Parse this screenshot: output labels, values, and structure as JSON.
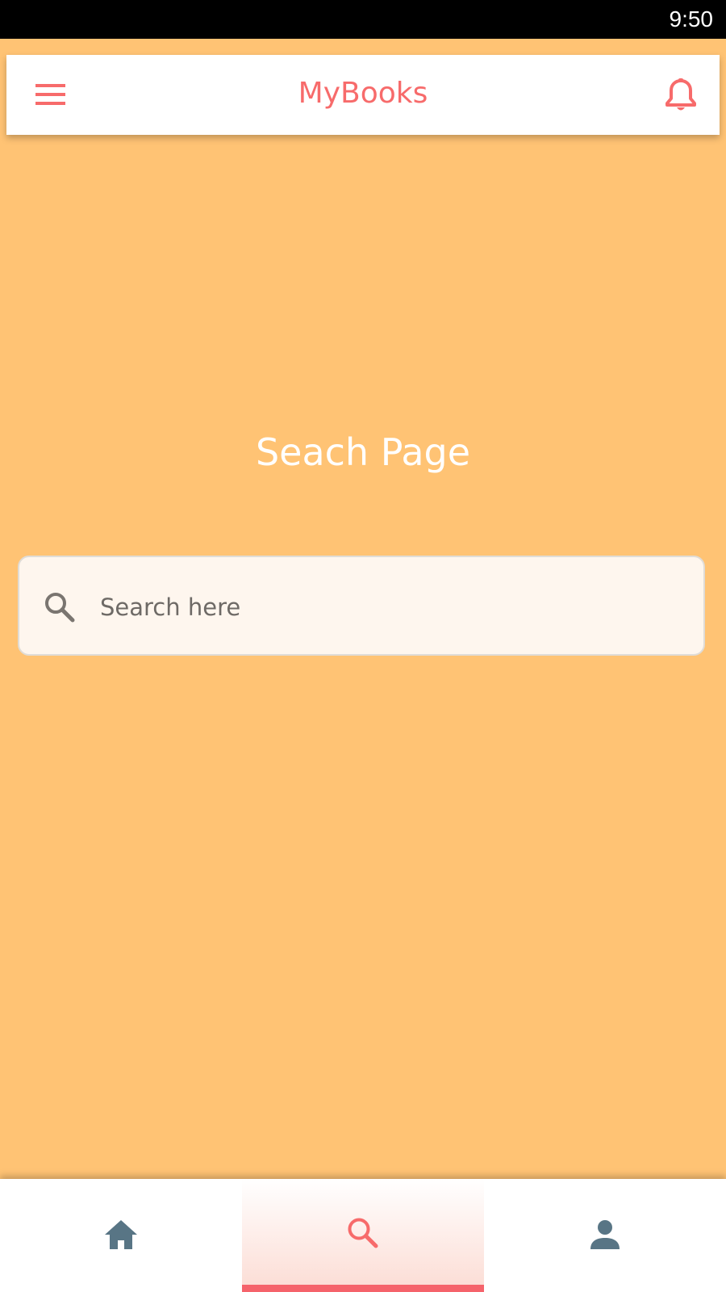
{
  "status_bar": {
    "time": "9:50"
  },
  "app_bar": {
    "title": "MyBooks",
    "menu_icon": "hamburger-menu-icon",
    "notification_icon": "bell-icon"
  },
  "page": {
    "heading": "Seach Page"
  },
  "search": {
    "placeholder": "Search here",
    "value": "",
    "icon": "search-icon"
  },
  "bottom_nav": {
    "items": [
      {
        "icon": "home-icon",
        "selected": false
      },
      {
        "icon": "search-icon",
        "selected": true
      },
      {
        "icon": "person-icon",
        "selected": false
      }
    ]
  },
  "colors": {
    "background": "#FFC374",
    "accent": "#F76B6B",
    "nav_icon_inactive": "#587585",
    "search_field_bg": "#FEF6EE",
    "status_bar": "#000000"
  }
}
